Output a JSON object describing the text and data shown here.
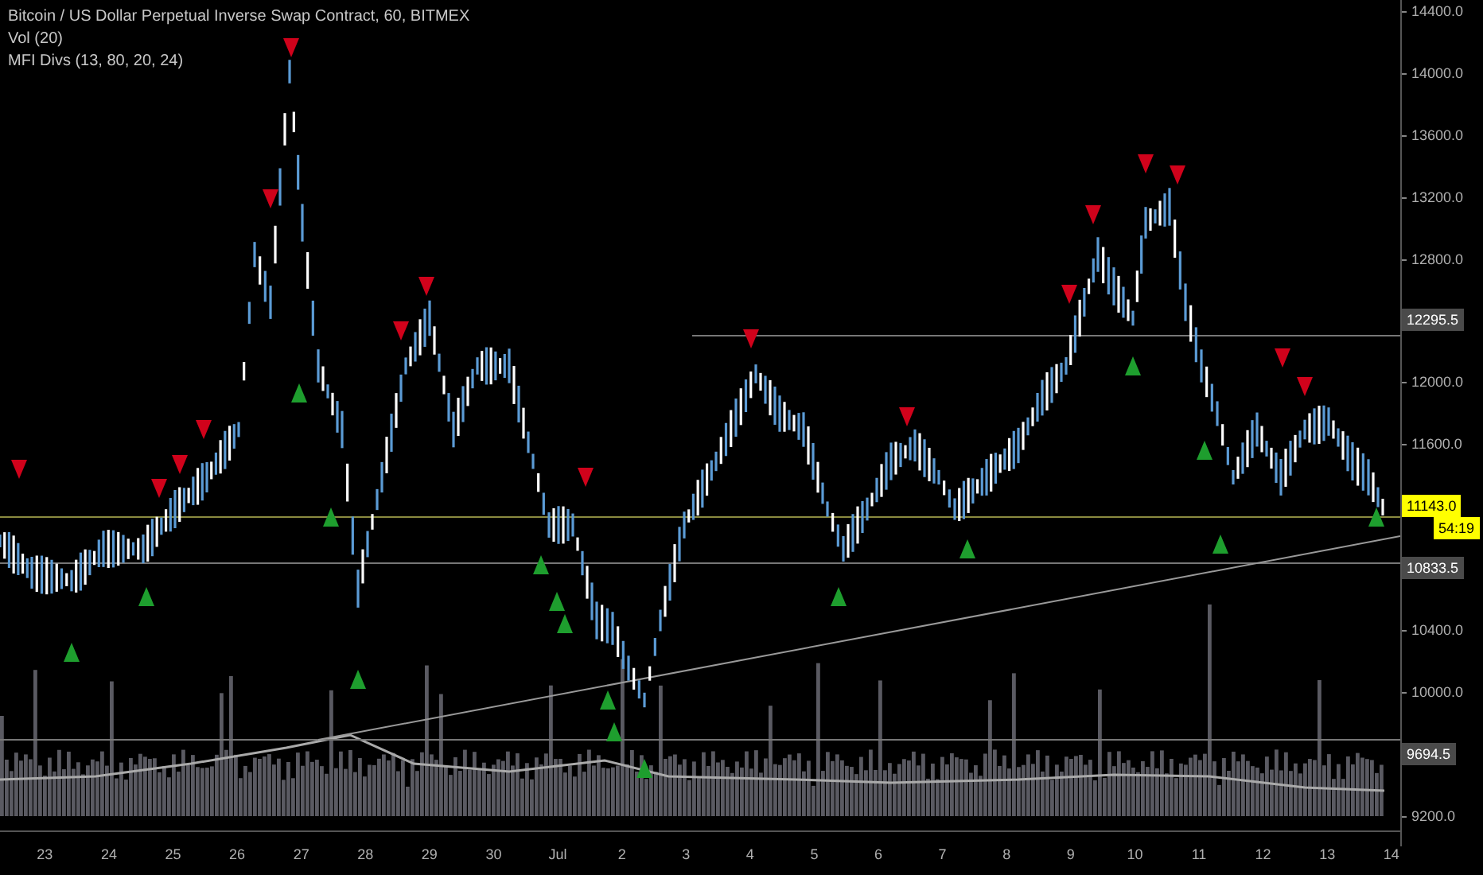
{
  "legend": [
    {
      "text": "Bitcoin / US Dollar Perpetual Inverse Swap Contract, 60, BITMEX"
    },
    {
      "text": "Vol (20)"
    },
    {
      "text": "MFI Divs (13, 80, 20, 24)"
    }
  ],
  "price_axis": [
    {
      "kind": "tick",
      "label": "14400.0"
    },
    {
      "kind": "tick",
      "label": "14000.0"
    },
    {
      "kind": "tick",
      "label": "13600.0"
    },
    {
      "kind": "tick",
      "label": "13200.0"
    },
    {
      "kind": "tick",
      "label": "12800.0"
    },
    {
      "kind": "badge",
      "label": "12295.5",
      "color": "#4a4a4a"
    },
    {
      "kind": "tick",
      "label": "12000.0"
    },
    {
      "kind": "tick",
      "label": "11600.0"
    },
    {
      "kind": "badge",
      "label": "11143.0",
      "sublabel": "54:19",
      "color": "#ffff00"
    },
    {
      "kind": "badge",
      "label": "10833.5",
      "color": "#4a4a4a"
    },
    {
      "kind": "tick",
      "label": "10400.0"
    },
    {
      "kind": "tick",
      "label": "10000.0"
    },
    {
      "kind": "badge",
      "label": "9694.5",
      "color": "#4a4a4a"
    },
    {
      "kind": "tick",
      "label": "9200.0"
    }
  ],
  "time_axis": [
    "23",
    "24",
    "25",
    "26",
    "27",
    "28",
    "29",
    "30",
    "Jul",
    "2",
    "3",
    "4",
    "5",
    "6",
    "7",
    "8",
    "9",
    "10",
    "11",
    "12",
    "13",
    "14"
  ]
}
